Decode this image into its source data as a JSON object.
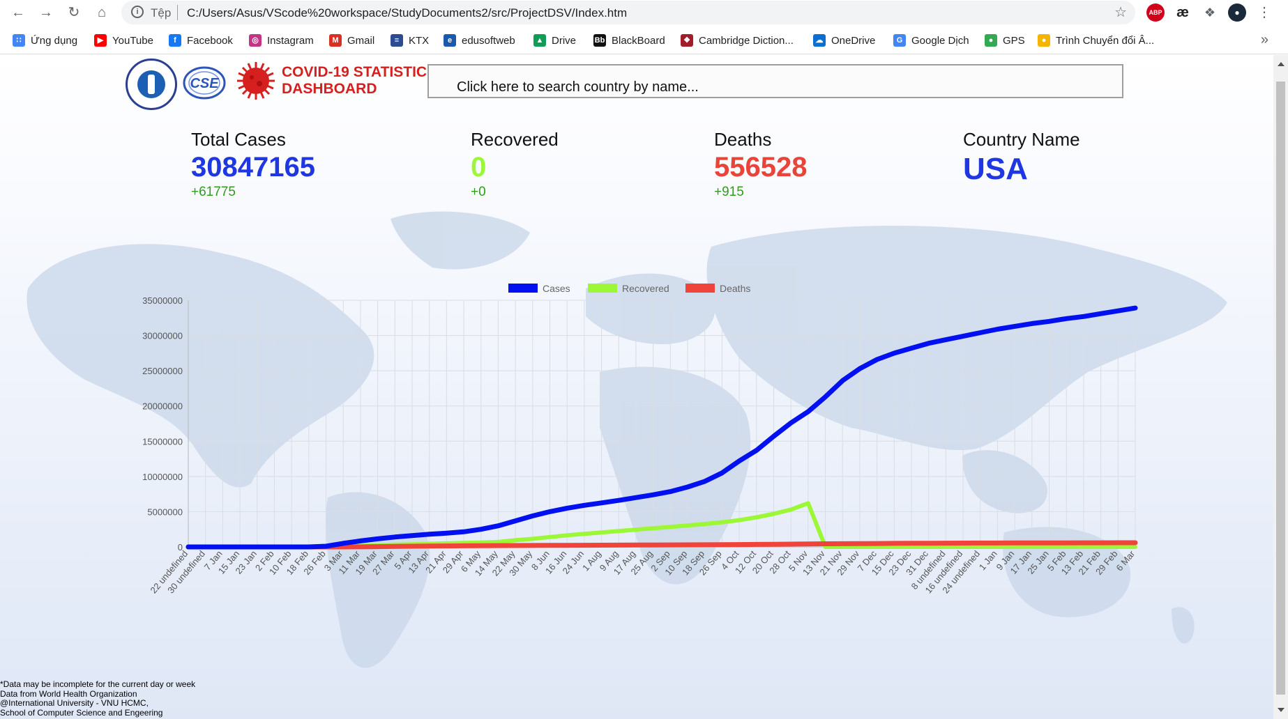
{
  "browser": {
    "scheme_label": "Tệp",
    "url": "C:/Users/Asus/VScode%20workspace/StudyDocuments2/src/ProjectDSV/Index.htm",
    "extensions": {
      "abp": "ABP",
      "ae": "æ"
    }
  },
  "bookmarks": [
    {
      "label": "Ứng dụng",
      "icon": "apps-grid-icon",
      "color": "#4285f4"
    },
    {
      "label": "YouTube",
      "icon": "youtube-icon",
      "color": "#ff0000"
    },
    {
      "label": "Facebook",
      "icon": "facebook-icon",
      "color": "#1877f2"
    },
    {
      "label": "Instagram",
      "icon": "instagram-icon",
      "color": "#c13584"
    },
    {
      "label": "Gmail",
      "icon": "gmail-icon",
      "color": "#d93025"
    },
    {
      "label": "KTX",
      "icon": "ktx-icon",
      "color": "#2d4b8f"
    },
    {
      "label": "edusoftweb",
      "icon": "edusoft-icon",
      "color": "#1a5aa8"
    },
    {
      "label": "Drive",
      "icon": "drive-icon",
      "color": "#0f9d58"
    },
    {
      "label": "BlackBoard",
      "icon": "blackboard-icon",
      "color": "#111111"
    },
    {
      "label": "Cambridge Diction...",
      "icon": "cambridge-icon",
      "color": "#a21c2b"
    },
    {
      "label": "OneDrive",
      "icon": "onedrive-icon",
      "color": "#0a6fd1"
    },
    {
      "label": "Google Dịch",
      "icon": "google-translate-icon",
      "color": "#4285f4"
    },
    {
      "label": "GPS",
      "icon": "globe-icon",
      "color": "#34a853"
    },
    {
      "label": "Trình Chuyển đổi Â...",
      "icon": "converter-icon",
      "color": "#f4b400"
    }
  ],
  "header": {
    "brand_line1": "COVID-19 STATISTIC",
    "brand_line2": "DASHBOARD",
    "logo_cse_text": "CSE",
    "search_placeholder": "Click here to search country by name..."
  },
  "stats": {
    "total_cases": {
      "label": "Total Cases",
      "value": "30847165",
      "delta": "+61775",
      "color": "#1f37e0"
    },
    "recovered": {
      "label": "Recovered",
      "value": "0",
      "delta": "+0",
      "color": "#9cf736"
    },
    "deaths": {
      "label": "Deaths",
      "value": "556528",
      "delta": "+915",
      "color": "#e8443a"
    },
    "country": {
      "label": "Country Name",
      "value": "USA",
      "color": "#1f37e0"
    }
  },
  "chart_data": {
    "type": "line",
    "legend_position": "top",
    "grid": true,
    "ylim": [
      0,
      35000000
    ],
    "yticks": [
      0,
      5000000,
      10000000,
      15000000,
      20000000,
      25000000,
      30000000,
      35000000
    ],
    "categories": [
      "22 undefined",
      "30 undefined",
      "7 Jan",
      "15 Jan",
      "23 Jan",
      "2 Feb",
      "10 Feb",
      "18 Feb",
      "26 Feb",
      "3 Mar",
      "11 Mar",
      "19 Mar",
      "27 Mar",
      "5 Apr",
      "13 Apr",
      "21 Apr",
      "29 Apr",
      "6 May",
      "14 May",
      "22 May",
      "30 May",
      "8 Jun",
      "16 Jun",
      "24 Jun",
      "1 Aug",
      "9 Aug",
      "17 Aug",
      "25 Aug",
      "2 Sep",
      "10 Sep",
      "18 Sep",
      "26 Sep",
      "4 Oct",
      "12 Oct",
      "20 Oct",
      "28 Oct",
      "5 Nov",
      "13 Nov",
      "21 Nov",
      "29 Nov",
      "7 Dec",
      "15 Dec",
      "23 Dec",
      "31 Dec",
      "8 undefined",
      "16 undefined",
      "24 undefined",
      "1 Jan",
      "9 Jan",
      "17 Jan",
      "25 Jan",
      "5 Feb",
      "13 Feb",
      "21 Feb",
      "29 Feb",
      "6 Mar"
    ],
    "series": [
      {
        "name": "Cases",
        "color": "#0010f0",
        "values": [
          0,
          0,
          0,
          0,
          0,
          0,
          0,
          0,
          100000,
          500000,
          850000,
          1150000,
          1400000,
          1600000,
          1800000,
          1950000,
          2150000,
          2500000,
          3000000,
          3700000,
          4400000,
          5000000,
          5500000,
          5900000,
          6250000,
          6600000,
          7000000,
          7400000,
          7850000,
          8500000,
          9300000,
          10500000,
          12200000,
          13700000,
          15700000,
          17600000,
          19200000,
          21300000,
          23600000,
          25300000,
          26600000,
          27500000,
          28200000,
          28900000,
          29400000,
          29900000,
          30400000,
          30900000,
          31300000,
          31700000,
          32000000,
          32400000,
          32700000,
          33100000,
          33500000,
          33900000
        ]
      },
      {
        "name": "Recovered",
        "color": "#9cf736",
        "values": [
          0,
          0,
          0,
          0,
          0,
          0,
          0,
          0,
          0,
          50000,
          150000,
          250000,
          320000,
          380000,
          440000,
          500000,
          560000,
          620000,
          700000,
          950000,
          1150000,
          1400000,
          1650000,
          1850000,
          2050000,
          2250000,
          2450000,
          2650000,
          2850000,
          3050000,
          3250000,
          3500000,
          3800000,
          4200000,
          4700000,
          5300000,
          6200000,
          0,
          0,
          0,
          0,
          0,
          0,
          0,
          0,
          0,
          0,
          0,
          0,
          0,
          0,
          0,
          0,
          0,
          0,
          0
        ]
      },
      {
        "name": "Deaths",
        "color": "#f0433a",
        "values": [
          0,
          0,
          0,
          0,
          0,
          0,
          0,
          0,
          0,
          0,
          10000,
          40000,
          80000,
          100000,
          120000,
          140000,
          160000,
          175000,
          185000,
          195000,
          205000,
          215000,
          225000,
          235000,
          245000,
          255000,
          265000,
          275000,
          285000,
          295000,
          310000,
          325000,
          340000,
          360000,
          380000,
          400000,
          420000,
          440000,
          455000,
          470000,
          485000,
          500000,
          515000,
          525000,
          535000,
          545000,
          550000,
          555000,
          560000,
          565000,
          570000,
          575000,
          580000,
          585000,
          590000,
          595000
        ]
      }
    ]
  },
  "footer": {
    "line1": "*Data may be incomplete for the current day or week",
    "line2": "Data from World Health Organization",
    "line3": "@International University - VNU HCMC,",
    "line4": "School of Computer Science and Engeering"
  }
}
